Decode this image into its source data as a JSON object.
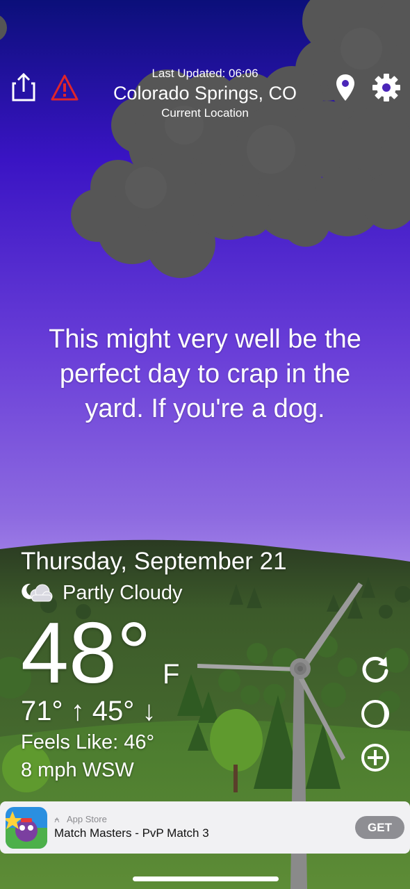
{
  "header": {
    "last_updated": "Last Updated: 06:06",
    "city": "Colorado Springs, CO",
    "location_label": "Current Location",
    "icons": [
      "share-icon",
      "warning-icon",
      "location-pin-icon",
      "gear-icon"
    ]
  },
  "quote": "This might very well be the perfect day to crap in the yard. If you're a dog.",
  "weather": {
    "date": "Thursday, September 21",
    "condition": "Partly Cloudy",
    "condition_icon": "partly-cloudy-night-icon",
    "temperature": "48°",
    "unit": "F",
    "hi_lo": "71° ↑ 45° ↓",
    "feels_like": "Feels Like: 46°",
    "wind": "8 mph WSW"
  },
  "side_buttons": [
    "refresh-icon",
    "moon-phase-icon",
    "add-icon"
  ],
  "ad": {
    "store_label": "App Store",
    "title": "Match Masters - PvP Match 3",
    "cta": "GET"
  },
  "colors": {
    "sky_top": "#0b0f7a",
    "sky_mid": "#6a3fd8",
    "sky_bottom": "#c7b1f6",
    "cloud": "#555555",
    "hills": "#3f6b2a",
    "warning_red": "#e0252b"
  }
}
